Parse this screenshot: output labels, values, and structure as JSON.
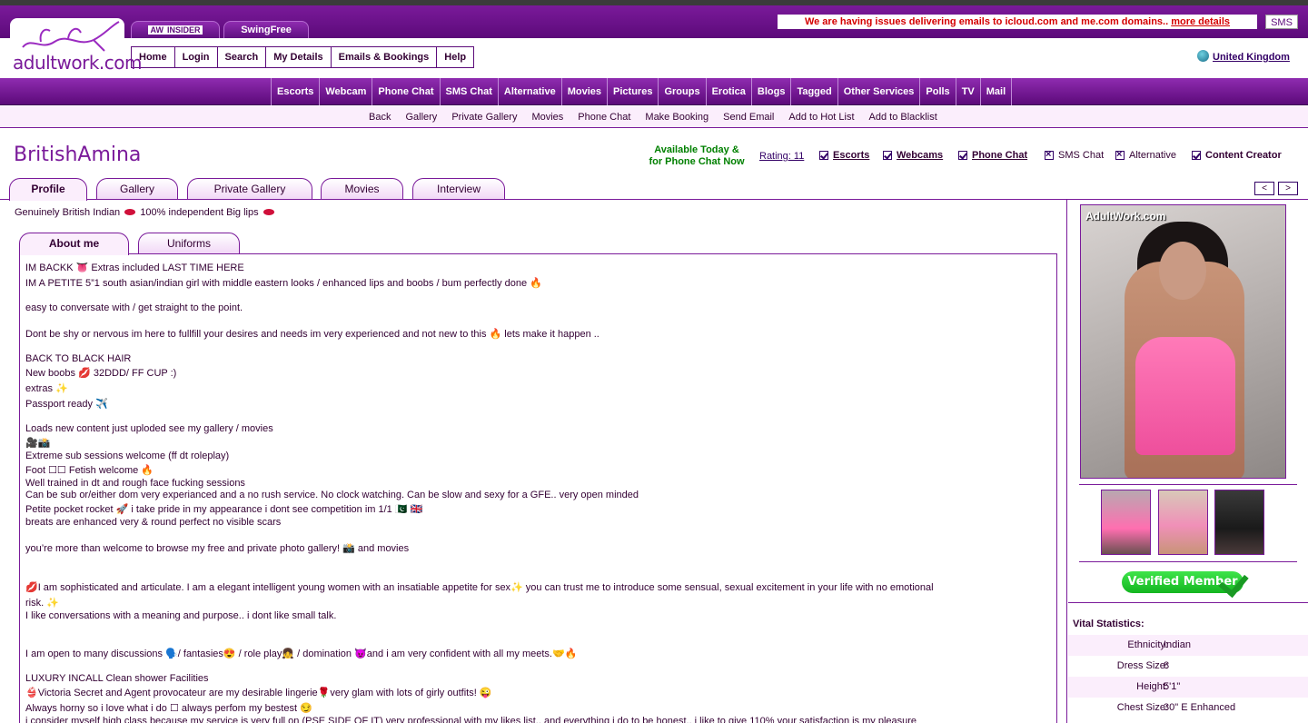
{
  "brand": {
    "logo_text": "adultwork.com"
  },
  "top_tabs": [
    {
      "prefix": "AW",
      "label": "INSIDER"
    },
    {
      "label": "SwingFree"
    }
  ],
  "notice": {
    "text": "We are having issues delivering emails to icloud.com and me.com domains..",
    "link": "more details"
  },
  "sms_button": "SMS",
  "main_nav": [
    "Home",
    "Login",
    "Search",
    "My Details",
    "Emails & Bookings",
    "Help"
  ],
  "country": "United Kingdom",
  "categories": [
    "Escorts",
    "Webcam",
    "Phone Chat",
    "SMS Chat",
    "Alternative",
    "Movies",
    "Pictures",
    "Groups",
    "Erotica",
    "Blogs",
    "Tagged",
    "Other Services",
    "Polls",
    "TV",
    "Mail"
  ],
  "sub_links": [
    "Back",
    "Gallery",
    "Private Gallery",
    "Movies",
    "Phone Chat",
    "Make Booking",
    "Send Email",
    "Add to Hot List",
    "Add to Blacklist"
  ],
  "profile": {
    "name": "BritishAmina",
    "available_line1": "Available Today &",
    "available_line2": "for Phone Chat Now",
    "rating": "Rating: 11",
    "services": [
      {
        "label": "Escorts",
        "checked": true
      },
      {
        "label": "Webcams",
        "checked": true
      },
      {
        "label": "Phone Chat",
        "checked": true
      },
      {
        "label": "SMS Chat",
        "checked": false
      },
      {
        "label": "Alternative",
        "checked": false
      },
      {
        "label": "Content Creator",
        "checked": true
      }
    ]
  },
  "profile_tabs": [
    "Profile",
    "Gallery",
    "Private Gallery",
    "Movies",
    "Interview"
  ],
  "pager": {
    "prev": "<",
    "next": ">"
  },
  "tagline_parts": [
    "Genuinely British Indian",
    "100% independent Big lips"
  ],
  "inner_tabs": [
    "About me",
    "Uniforms"
  ],
  "about_lines": [
    "IM BACKK 👅 Extras included LAST TIME HERE",
    "IM A PETITE 5”1 south asian/indian girl with middle eastern looks / enhanced lips and boobs / bum perfectly done 🔥",
    "easy to conversate with / get straight to the point.",
    "Dont be shy or nervous im here to fullfill your desires and needs im very experienced and not new to this 🔥 lets make it happen ..",
    "BACK TO BLACK HAIR",
    "New boobs 💋 32DDD/ FF CUP :)",
    "extras ✨",
    "Passport ready ✈️",
    "Loads new content just uploded see my gallery / movies",
    "🎥📸",
    "Extreme sub sessions welcome (ff dt roleplay)",
    "Foot ☐☐ Fetish welcome 🔥",
    "Well trained in dt and rough face fucking sessions",
    "Can be sub or/either dom very experianced and a no rush service. No clock watching. Can be slow and sexy for a GFE.. very open minded",
    "Petite pocket rocket 🚀 i take pride in my appearance i dont see competition im 1/1 🇵🇰 🇬🇧",
    "breats are enhanced very & round perfect no visible scars",
    "you’re more than welcome to browse my free and private photo gallery! 📸 and movies",
    "💋I am sophisticated and articulate. I am a elegant intelligent young women with an insatiable appetite for sex✨ you can trust me to introduce some sensual, sexual excitement in your life with no emotional",
    "risk. ✨",
    "I like conversations with a meaning and purpose.. i dont like small talk.",
    "I am open to many discussions 🗣️/ fantasies😍 / role play👧 / domination 😈and i am very confident with all my meets.🤝🔥",
    "LUXURY INCALL Clean shower Facilities",
    "👙Victoria Secret and Agent provocateur are my desirable lingerie🌹very glam with lots of girly outfits! 😜",
    "Always horny so i love what i do ☐ always perfom my bestest 😏",
    "i consider myself high class because my service is very full on (PSE SIDE OF IT) very professional with my likes list.. and everything i do to be honest.. i like to give 110% your satisfaction is my pleasure"
  ],
  "photo_watermark": "AdultWork.com",
  "verified": "Verified Member",
  "vital_heading": "Vital Statistics:",
  "vitals": [
    {
      "k": "Ethnicity:",
      "v": "Indian"
    },
    {
      "k": "Dress Size:",
      "v": "8"
    },
    {
      "k": "Height:",
      "v": "5'1\""
    },
    {
      "k": "Chest Size:",
      "v": "30\" E Enhanced"
    }
  ]
}
